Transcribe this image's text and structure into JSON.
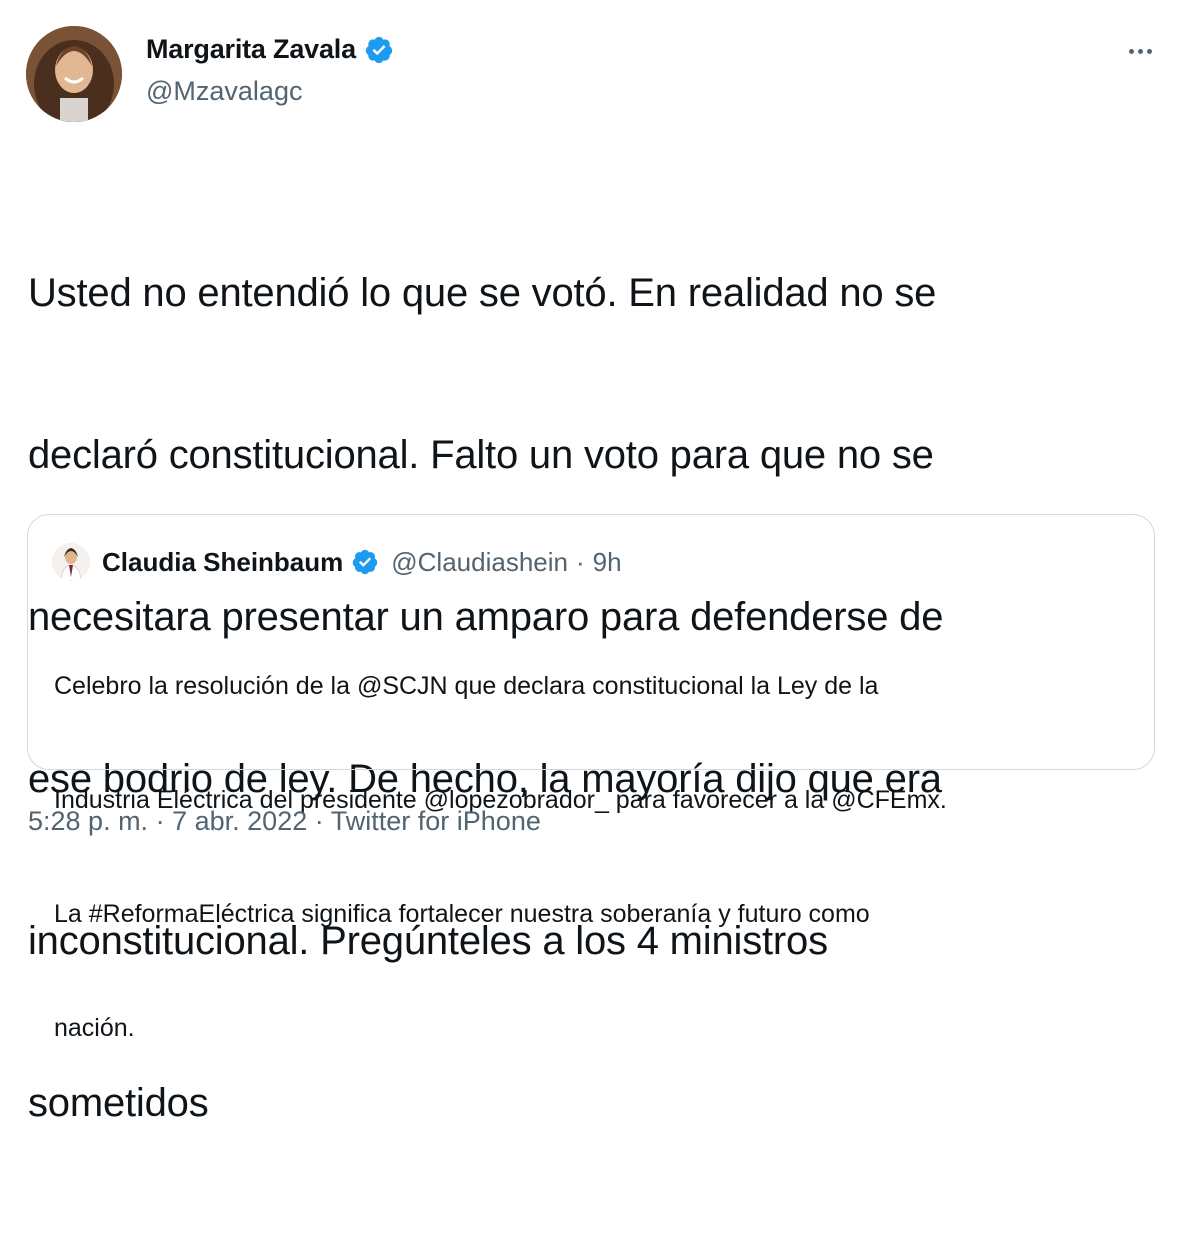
{
  "author": {
    "display_name": "Margarita Zavala",
    "handle": "@Mzavalagc",
    "verified_icon": "verified-badge-icon"
  },
  "more_icon": "more-options-icon",
  "tweet": {
    "text_lines": [
      "Usted no entendió lo que se votó. En realidad no se",
      "declaró constitucional. Falto un voto para que no se",
      "necesitara presentar un amparo para defenderse de",
      "ese bodrio de ley. De hecho, la mayoría dijo que era",
      "inconstitucional. Pregúnteles a los 4 ministros",
      "sometidos"
    ]
  },
  "quoted_tweet": {
    "display_name": "Claudia Sheinbaum",
    "handle": "@Claudiashein",
    "separator": "·",
    "time": "9h",
    "text_lines": [
      "Celebro la resolución de la @SCJN que declara constitucional la Ley de la",
      "Industria Eléctrica del presidente @lopezobrador_ para favorecer a la @CFEmx.",
      "La #ReformaEléctrica significa fortalecer nuestra soberanía y futuro como",
      "nación."
    ]
  },
  "meta": {
    "time": "5:28 p. m.",
    "sep1": "·",
    "date": "7 abr. 2022",
    "sep2": "·",
    "source": "Twitter for iPhone"
  },
  "colors": {
    "text": "#0f1419",
    "secondary": "#536471",
    "verified": "#1d9bf0",
    "border": "#cfd9de"
  }
}
